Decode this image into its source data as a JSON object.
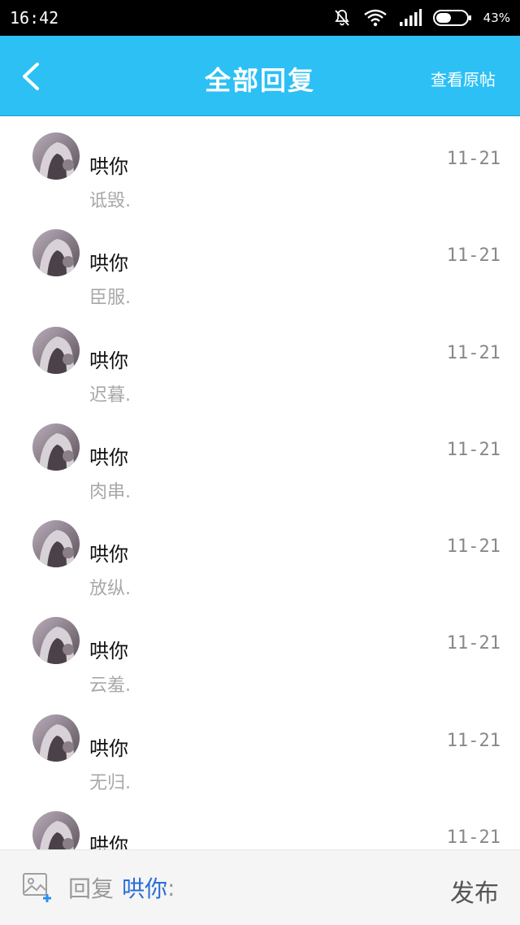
{
  "status_bar": {
    "time": "16:42",
    "battery": "43%",
    "icons": [
      "mute-bell-icon",
      "wifi-icon",
      "signal-icon",
      "battery-icon"
    ]
  },
  "header": {
    "title": "全部回复",
    "right_action": "查看原帖",
    "back_icon": "chevron-left-icon"
  },
  "replies": [
    {
      "name": "哄你",
      "text": "诋毁.",
      "date": "11-21"
    },
    {
      "name": "哄你",
      "text": "臣服.",
      "date": "11-21"
    },
    {
      "name": "哄你",
      "text": "迟暮.",
      "date": "11-21"
    },
    {
      "name": "哄你",
      "text": "肉串.",
      "date": "11-21"
    },
    {
      "name": "哄你",
      "text": "放纵.",
      "date": "11-21"
    },
    {
      "name": "哄你",
      "text": "云羞.",
      "date": "11-21"
    },
    {
      "name": "哄你",
      "text": "无归.",
      "date": "11-21"
    },
    {
      "name": "哄你",
      "text": "",
      "date": "11-21"
    }
  ],
  "composer": {
    "prefix": "回复",
    "target": "哄你",
    "colon": ":",
    "publish_label": "发布",
    "image_icon": "add-image-icon"
  },
  "colors": {
    "header_bg": "#2cc0f5",
    "link": "#2a6ed8"
  }
}
